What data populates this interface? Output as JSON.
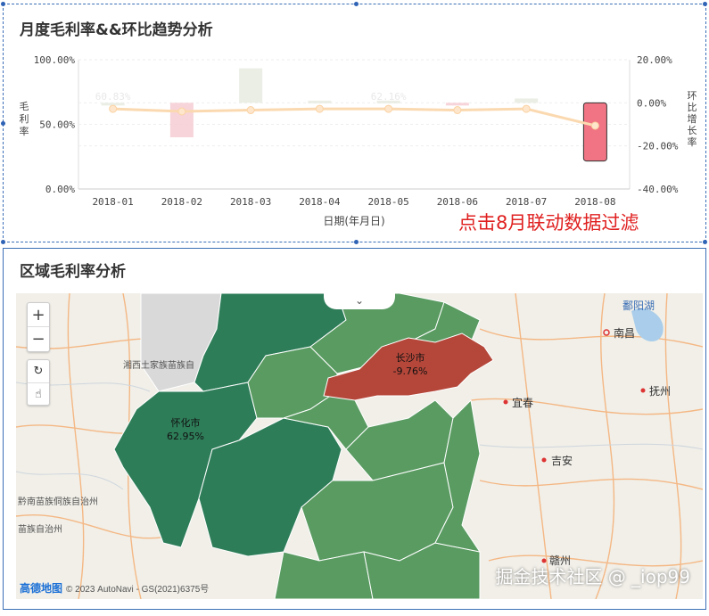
{
  "top_panel": {
    "title": "月度毛利率&&环比趋势分析",
    "annotation": "点击8月联动数据过滤",
    "annotation_color": "#e02020"
  },
  "chart_data": {
    "type": "bar",
    "categories": [
      "2018-01",
      "2018-02",
      "2018-03",
      "2018-04",
      "2018-05",
      "2018-06",
      "2018-07",
      "2018-08"
    ],
    "xlabel": "日期(年月日)",
    "ylabel": "毛利率",
    "y2label": "环比增长率",
    "left_ticks": [
      "100.00%",
      "50.00%",
      "0.00%"
    ],
    "right_ticks": [
      "20.00%",
      "0.00%",
      "-20.00%",
      "-40.00%"
    ],
    "ylim": [
      0,
      100
    ],
    "y2lim": [
      -40,
      20
    ],
    "series": [
      {
        "kind": "line",
        "axis": "left",
        "values": [
          62,
          60,
          61,
          62,
          62,
          61,
          62,
          49
        ]
      },
      {
        "kind": "bar",
        "axis": "right",
        "values": [
          0,
          -16,
          16,
          1,
          1,
          -1,
          2,
          -27
        ]
      }
    ],
    "bar_colors": {
      "positive": "#e6ebe0",
      "negative": "#f6cdd3",
      "selected": "#f07483"
    },
    "selected_category": "2018-08",
    "faded_labels": [
      "60.83%",
      "",
      "",
      "",
      "62.16%",
      "",
      "",
      ""
    ],
    "grid": true
  },
  "map_panel": {
    "title": "区域毛利率分析",
    "regions": [
      {
        "name": "怀化市",
        "value": "62.95%",
        "color": "#2e7d59"
      },
      {
        "name": "长沙市",
        "value": "-9.76%",
        "color": "#b5473a"
      }
    ],
    "cities": [
      "南昌",
      "宜春",
      "抚州",
      "吉安",
      "赣州"
    ],
    "lake": "鄱阳湖",
    "areas": [
      "湘西土家族苗族自",
      "黔南苗族侗族自治州",
      "苗族自治州"
    ],
    "controls": {
      "zoom_in": "+",
      "zoom_out": "−",
      "collapse": "⌄"
    },
    "attribution_brand": "高德地图",
    "attribution": "© 2023 AutoNavi - GS(2021)6375号",
    "watermark": "掘金技术社区 @ _iop99",
    "colors": {
      "dark_green": "#2e7d59",
      "light_green": "#5a9b62",
      "red": "#b5473a"
    }
  }
}
